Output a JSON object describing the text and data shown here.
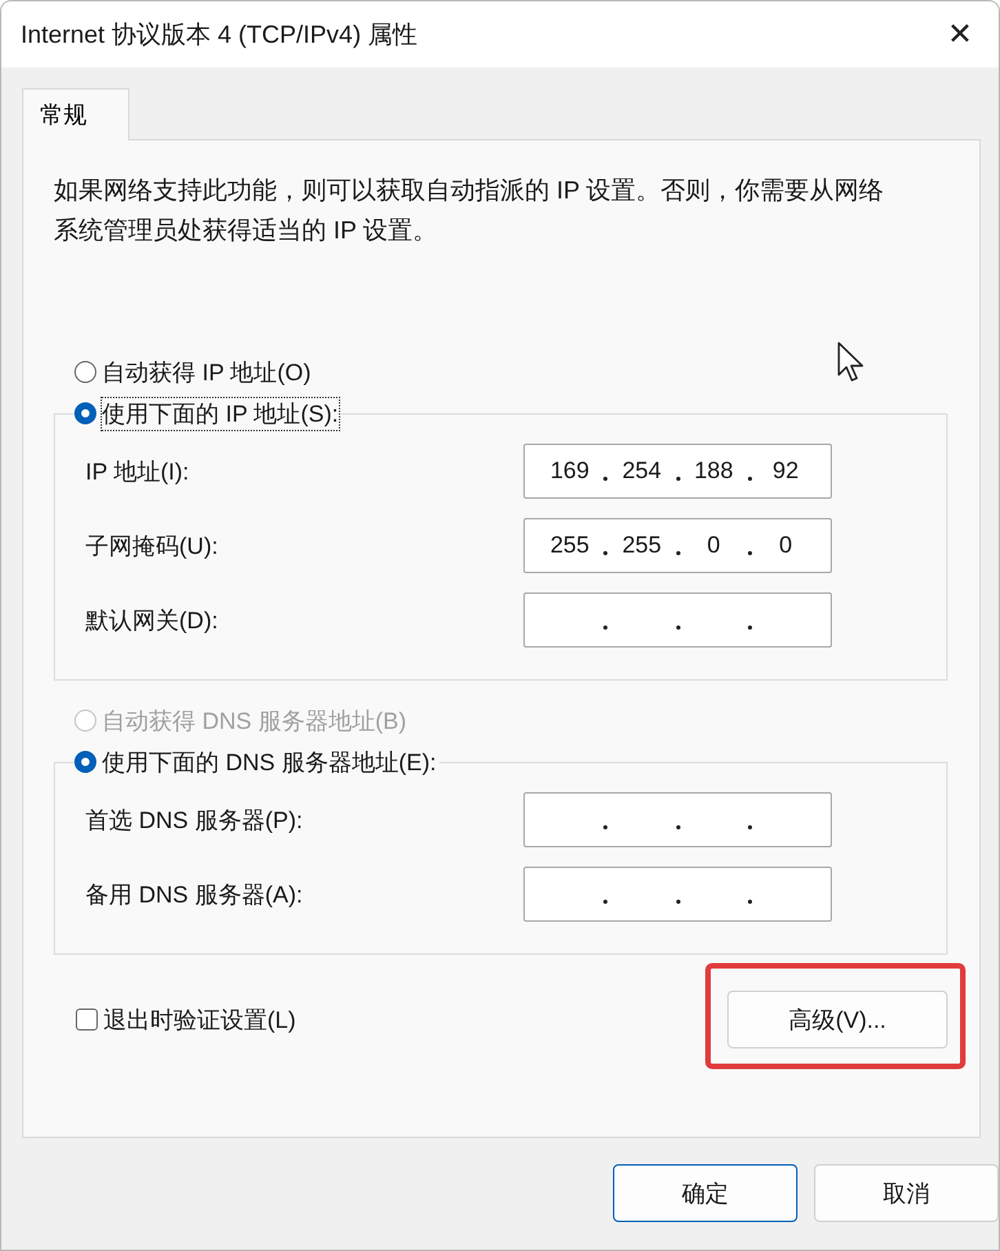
{
  "window": {
    "title": "Internet 协议版本 4 (TCP/IPv4) 属性",
    "close": "✕"
  },
  "tabs": [
    {
      "label": "常规",
      "selected": true
    }
  ],
  "description": "如果网络支持此功能，则可以获取自动指派的 IP 设置。否则，你需要从网络系统管理员处获得适当的 IP 设置。",
  "sections": [
    {
      "auto": {
        "label": "自动获得 IP 地址(O)",
        "selected": false,
        "disabled": false
      },
      "manual": {
        "label": "使用下面的 IP 地址(S):",
        "selected": true,
        "focused": true
      },
      "fields": [
        {
          "label": "IP 地址(I):",
          "octets": [
            "169",
            "254",
            "188",
            "92"
          ]
        },
        {
          "label": "子网掩码(U):",
          "octets": [
            "255",
            "255",
            "0",
            "0"
          ]
        },
        {
          "label": "默认网关(D):"
        }
      ]
    },
    {
      "auto": {
        "label": "自动获得 DNS 服务器地址(B)",
        "selected": false,
        "disabled": true
      },
      "manual": {
        "label": "使用下面的 DNS 服务器地址(E):",
        "selected": true,
        "focused": false
      },
      "fields": [
        {
          "label": "首选 DNS 服务器(P):"
        },
        {
          "label": "备用 DNS 服务器(A):"
        }
      ]
    }
  ],
  "validate": {
    "label": "退出时验证设置(L)",
    "checked": false
  },
  "advanced": {
    "label": "高级(V)...",
    "highlighted": true
  },
  "buttons": [
    {
      "label": "确定",
      "default": true
    },
    {
      "label": "取消",
      "default": false
    }
  ]
}
